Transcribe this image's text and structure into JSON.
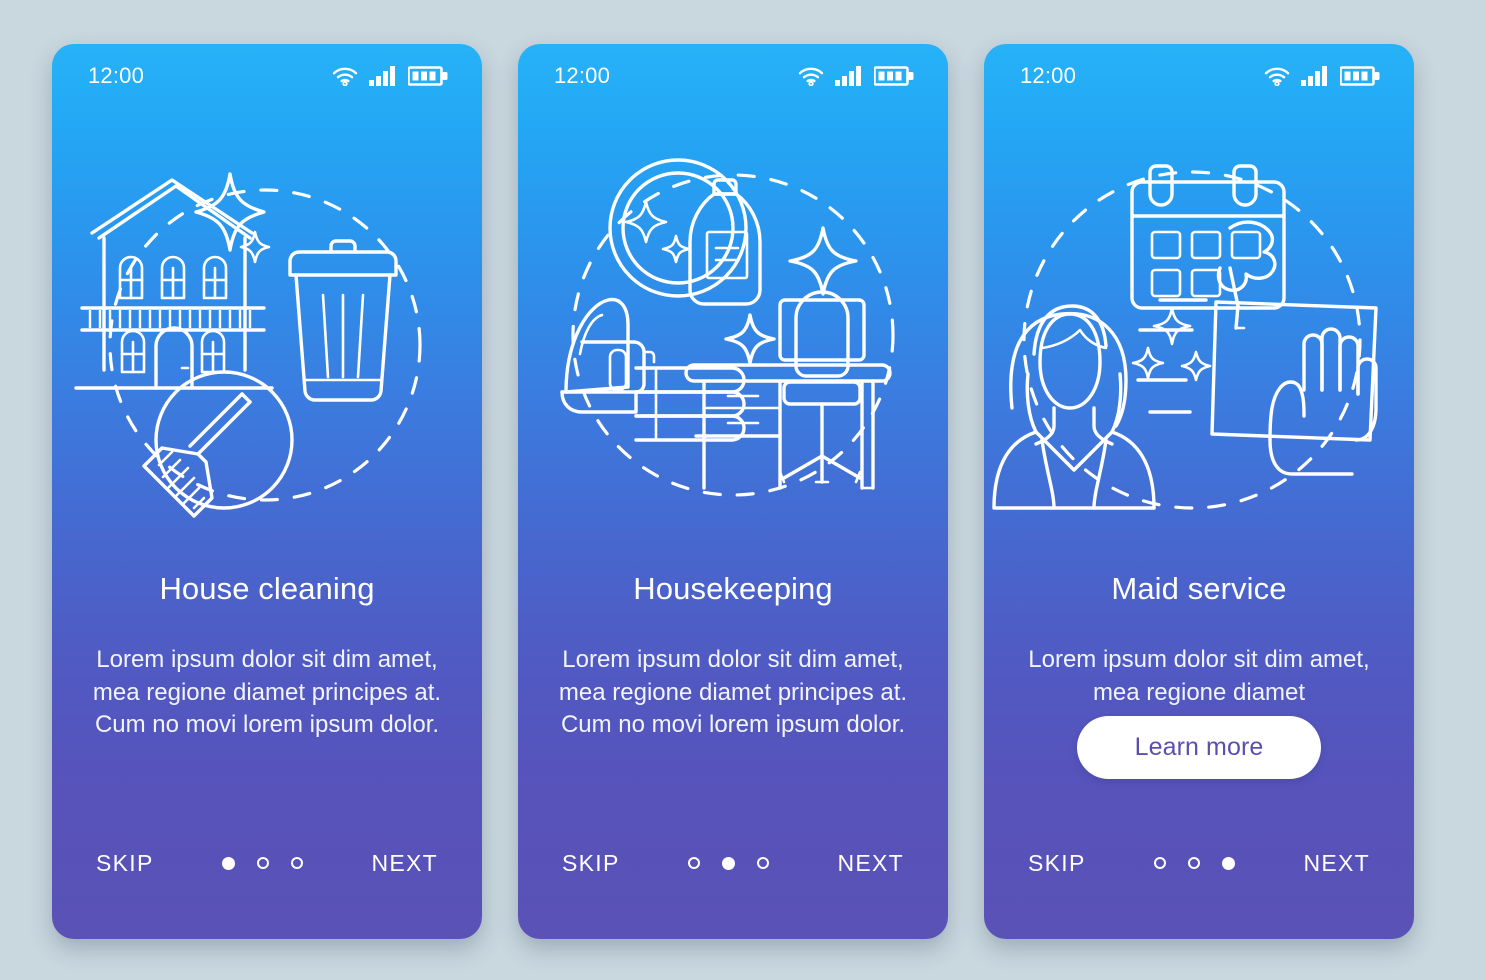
{
  "background_color": "#c9d7df",
  "gradient": {
    "top": "#27b2f7",
    "bottom": "#5a52b5"
  },
  "accent_text_color": "#5a4fb0",
  "screens": [
    {
      "status": {
        "time": "12:00",
        "wifi_icon": "wifi-icon",
        "signal_icon": "signal-bars-icon",
        "battery_icon": "battery-icon"
      },
      "illustration": "house-cleaning-illustration",
      "title": "House cleaning",
      "description": "Lorem ipsum dolor sit dim amet, mea regione diamet principes at. Cum no movi lorem ipsum dolor.",
      "cta": null,
      "footer": {
        "skip_label": "SKIP",
        "next_label": "NEXT",
        "dots": 3,
        "active_dot": 0
      }
    },
    {
      "status": {
        "time": "12:00",
        "wifi_icon": "wifi-icon",
        "signal_icon": "signal-bars-icon",
        "battery_icon": "battery-icon"
      },
      "illustration": "housekeeping-illustration",
      "title": "Housekeeping",
      "description": "Lorem ipsum dolor sit dim amet, mea regione diamet principes at. Cum no movi lorem ipsum dolor.",
      "cta": null,
      "footer": {
        "skip_label": "SKIP",
        "next_label": "NEXT",
        "dots": 3,
        "active_dot": 1
      }
    },
    {
      "status": {
        "time": "12:00",
        "wifi_icon": "wifi-icon",
        "signal_icon": "signal-bars-icon",
        "battery_icon": "battery-icon"
      },
      "illustration": "maid-service-illustration",
      "title": "Maid service",
      "description": "Lorem ipsum dolor sit dim amet, mea regione diamet",
      "cta": "Learn more",
      "footer": {
        "skip_label": "SKIP",
        "next_label": "NEXT",
        "dots": 3,
        "active_dot": 2
      }
    }
  ]
}
